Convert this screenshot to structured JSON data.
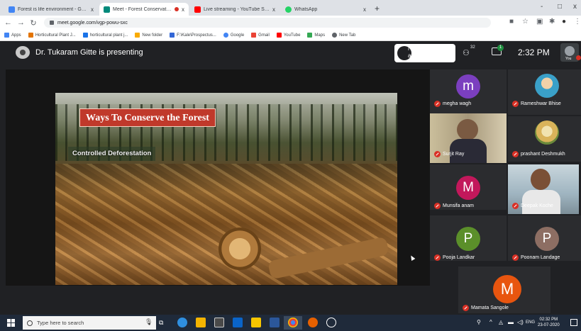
{
  "browser": {
    "tabs": [
      {
        "title": "Forest is life environment - Goo...",
        "favicon_color": "#4285f4",
        "active": false
      },
      {
        "title": "Meet - Forest Conservation",
        "favicon_color": "#00897b",
        "active": true,
        "recording": true
      },
      {
        "title": "Live streaming - YouTube Studio",
        "favicon_color": "#ff0000",
        "active": false
      },
      {
        "title": "WhatsApp",
        "favicon_color": "#25d366",
        "active": false
      }
    ],
    "close_glyph": "x",
    "new_tab_glyph": "+",
    "window_controls": [
      "-",
      "□",
      "x"
    ],
    "url": "meet.google.com/vgp-powu-sxc",
    "bookmarks": [
      {
        "label": "Apps",
        "color": "#4285f4"
      },
      {
        "label": "Horticultural Plant J...",
        "color": "#e37400"
      },
      {
        "label": "horticultural plant j...",
        "color": "#1a73e8"
      },
      {
        "label": "New folder",
        "color": "#f9ab00"
      },
      {
        "label": "F:\\Kale\\Prospectus...",
        "color": "#3367d6"
      },
      {
        "label": "Google",
        "color": "#4285f4"
      },
      {
        "label": "Gmail",
        "color": "#ea4335"
      },
      {
        "label": "YouTube",
        "color": "#ff0000"
      },
      {
        "label": "Maps",
        "color": "#34a853"
      },
      {
        "label": "New Tab",
        "color": "#5f6368"
      }
    ]
  },
  "meet": {
    "presenter_text": "Dr. Tukaram Gitte is presenting",
    "people_pill": {
      "line1": "Nusrat Parveen",
      "line2": "and 20 more"
    },
    "people_count": "32",
    "chat_badge": "1",
    "clock": "2:32 PM",
    "self_label": "You",
    "slide": {
      "title": "Ways To Conserve the Forest",
      "subtitle": "Controlled Deforestation"
    },
    "participants": [
      {
        "name": "megha wagh",
        "initial": "m",
        "avatar_color": "#7b3fbf",
        "kind": "initial"
      },
      {
        "name": "Rameshwar Bhise",
        "initial": "",
        "avatar_color": "#5aa0c8",
        "kind": "photo"
      },
      {
        "name": "Surjit Ray",
        "initial": "",
        "avatar_color": "#8f7a5a",
        "kind": "video"
      },
      {
        "name": "prashant Deshmukh",
        "initial": "",
        "avatar_color": "#d9b35a",
        "kind": "photo"
      },
      {
        "name": "Munsifa anam",
        "initial": "M",
        "avatar_color": "#c2185b",
        "kind": "initial"
      },
      {
        "name": "Deepak Koche",
        "initial": "",
        "avatar_color": "#9fb4c0",
        "kind": "video"
      },
      {
        "name": "Pooja Landkar",
        "initial": "P",
        "avatar_color": "#5b8f2a",
        "kind": "initial"
      },
      {
        "name": "Poonam Landage",
        "initial": "P",
        "avatar_color": "#8d6e63",
        "kind": "initial"
      },
      {
        "name": "Mamata Sangole",
        "initial": "M",
        "avatar_color": "#e8550f",
        "kind": "initial"
      }
    ]
  },
  "taskbar": {
    "search_placeholder": "Type here to search",
    "tray_lang": "ENG",
    "time": "02:32 PM",
    "date": "23-07-2020"
  }
}
